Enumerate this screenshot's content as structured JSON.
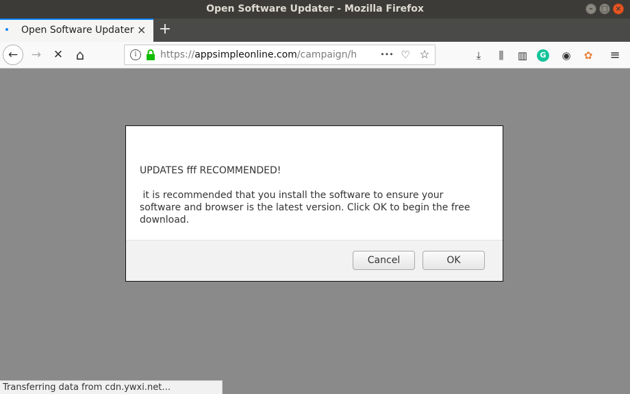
{
  "window": {
    "title": "Open Software Updater - Mozilla Firefox"
  },
  "tab": {
    "label": "Open Software Updater",
    "close": "×"
  },
  "newtab": "+",
  "nav": {
    "back": "←",
    "forward": "→",
    "stop": "✕",
    "home": "⌂"
  },
  "urlbar": {
    "url_prefix": "https://",
    "url_host": "appsimpleonline.com",
    "url_path": "/campaign/h",
    "more": "•••",
    "pocket": "♡",
    "bookmark": "☆"
  },
  "toolbar": {
    "download": "⤓",
    "library": "⫼",
    "sidebar": "▥",
    "grammarly": "G",
    "account": "◉",
    "extension": "✿",
    "menu": "≡"
  },
  "dialog": {
    "title": "UPDATES fff RECOMMENDED!",
    "message": " it is recommended that you install the software to ensure your software and browser is the latest version. Click OK to begin the free download.",
    "cancel_label": "Cancel",
    "ok_label": "OK"
  },
  "status": {
    "text": "Transferring data from cdn.ywxi.net…"
  },
  "colors": {
    "accent": "#0a84ff",
    "titlebar": "#3c3b37",
    "close": "#e95420",
    "lock": "#12bc00",
    "grammarly": "#15c39a"
  }
}
